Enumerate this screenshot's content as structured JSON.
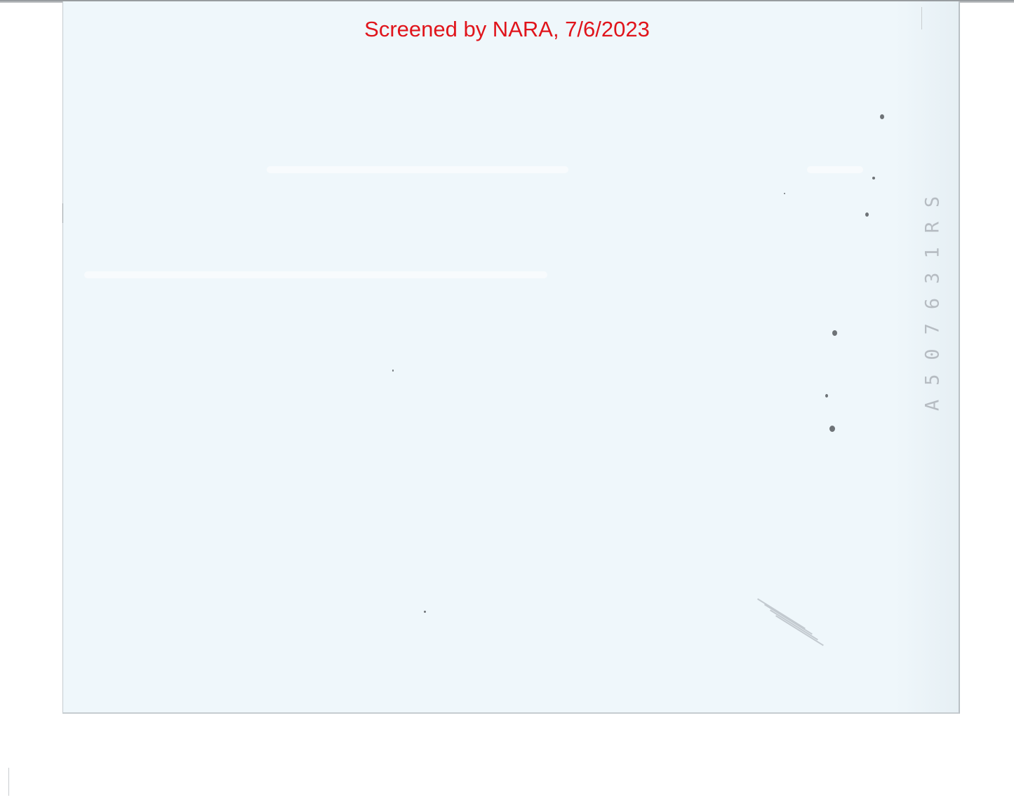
{
  "stamp": {
    "text": "Screened by NARA, 7/6/2023",
    "color": "#e0141b"
  },
  "serial_number": {
    "text": "A507631RS",
    "color": "#b6bcc2"
  },
  "card": {
    "background": "#eff7fb"
  }
}
